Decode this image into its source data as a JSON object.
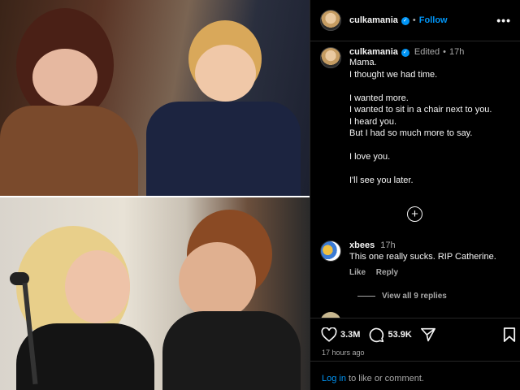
{
  "post": {
    "username": "culkamania",
    "follow_label": "Follow",
    "more_label": "•••",
    "separator": "•"
  },
  "caption": {
    "username": "culkamania",
    "edited_label": "Edited",
    "separator": "•",
    "time": "17h",
    "lines": [
      "Mama.",
      "I thought we had time.",
      "",
      "I wanted more.",
      "I wanted to sit in a chair next to you.",
      "I heard you.",
      "But I had so much more to say.",
      "",
      "I love you.",
      "",
      "I'll see you later."
    ]
  },
  "load_more": {
    "icon": "plus-circle-icon",
    "label": "+"
  },
  "comment": {
    "username": "xbees",
    "time": "17h",
    "text": "This one really sucks. RIP Catherine.",
    "like_label": "Like",
    "reply_label": "Reply",
    "view_replies_label": "View all 9 replies"
  },
  "actions": {
    "likes": "3.3M",
    "comments": "53.9K",
    "timeago": "17 hours ago",
    "login_link": "Log in",
    "login_rest": " to like or comment."
  },
  "colors": {
    "background": "#000000",
    "accent": "#0095f6",
    "muted": "#a8a8a8",
    "divider": "#262626"
  }
}
